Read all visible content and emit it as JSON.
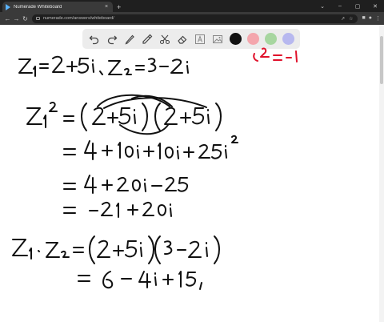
{
  "browser": {
    "tab_title": "Numerade Whiteboard",
    "tab_close": "×",
    "new_tab": "+",
    "url": "numerade.com/answers/whiteboard/",
    "window_controls": [
      "⌄",
      "–",
      "▢",
      "✕"
    ]
  },
  "toolbar": {
    "tools": [
      "undo-icon",
      "redo-icon",
      "pen-icon",
      "highlighter-icon",
      "scissors-icon",
      "eraser-icon",
      "text-icon",
      "image-icon"
    ],
    "colors": [
      "#111111",
      "#f4a6ad",
      "#a7d6a0",
      "#b7b8ef"
    ]
  },
  "board": {
    "ink_color": "#111111",
    "accent_ink": "#e0112b"
  }
}
